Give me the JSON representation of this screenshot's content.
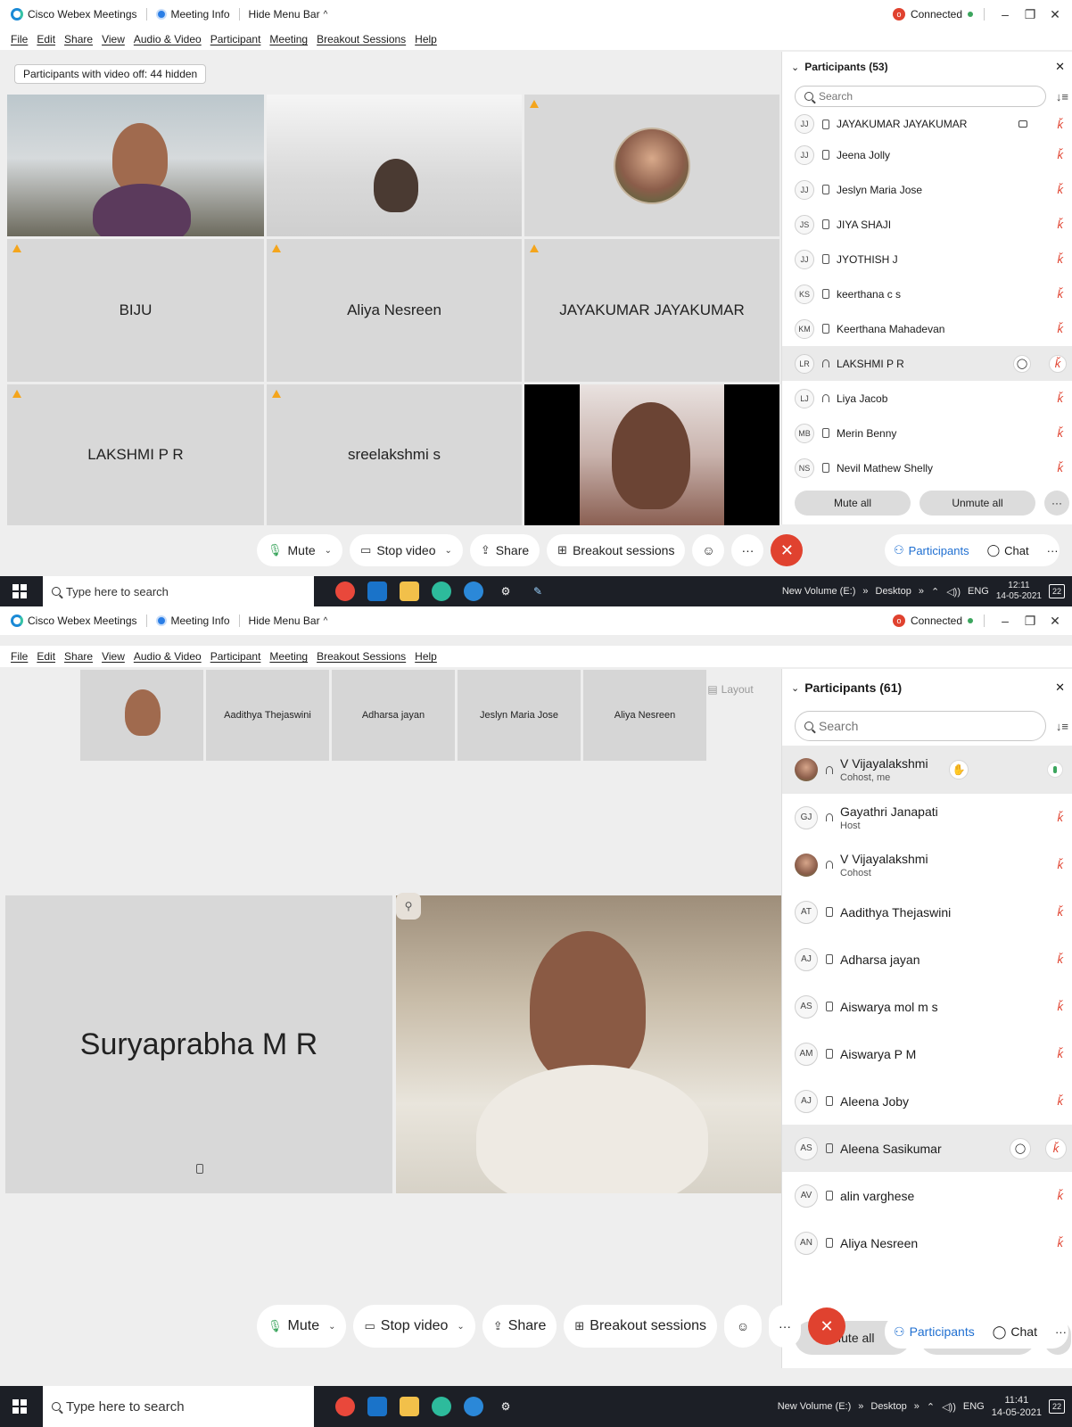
{
  "app": {
    "title": "Cisco Webex Meetings",
    "meeting_info": "Meeting Info",
    "hide_menu": "Hide Menu Bar",
    "connected": "Connected"
  },
  "menu": [
    "File",
    "Edit",
    "Share",
    "View",
    "Audio & Video",
    "Participant",
    "Meeting",
    "Breakout Sessions",
    "Help"
  ],
  "controls": {
    "mute": "Mute",
    "stop_video": "Stop video",
    "share": "Share",
    "breakout": "Breakout sessions",
    "participants": "Participants",
    "chat": "Chat",
    "more": "···"
  },
  "panel_common": {
    "search_placeholder": "Search",
    "mute_all": "Mute all",
    "unmute_all": "Unmute all"
  },
  "taskbar": {
    "search_placeholder": "Type here to search",
    "new_volume": "New Volume (E:)",
    "desktop": "Desktop",
    "lang": "ENG",
    "notifications": "22"
  },
  "screen1": {
    "hidden_note": "Participants with video off: 44 hidden",
    "tiles": [
      "BIJU",
      "Aliya Nesreen",
      "JAYAKUMAR JAYAKUMAR",
      "LAKSHMI P R",
      "sreelakshmi s"
    ],
    "panel_title": "Participants (53)",
    "participants": [
      {
        "initials": "JJ",
        "name": "JAYAKUMAR JAYAKUMAR"
      },
      {
        "initials": "JJ",
        "name": "Jeena Jolly"
      },
      {
        "initials": "JJ",
        "name": "Jeslyn Maria Jose"
      },
      {
        "initials": "JS",
        "name": "JIYA SHAJI"
      },
      {
        "initials": "JJ",
        "name": "JYOTHISH J"
      },
      {
        "initials": "KS",
        "name": "keerthana c s"
      },
      {
        "initials": "KM",
        "name": "Keerthana Mahadevan"
      },
      {
        "initials": "LR",
        "name": "LAKSHMI P R"
      },
      {
        "initials": "LJ",
        "name": "Liya Jacob"
      },
      {
        "initials": "MB",
        "name": "Merin Benny"
      },
      {
        "initials": "NS",
        "name": "Nevil Mathew Shelly"
      }
    ],
    "time": "12:11",
    "date": "14-05-2021"
  },
  "screen2": {
    "filmstrip": [
      "Aadithya Thejaswini",
      "Adharsa jayan",
      "Jeslyn Maria Jose",
      "Aliya Nesreen"
    ],
    "layout": "Layout",
    "main_tile": "Suryaprabha M R",
    "panel_title": "Participants (61)",
    "participants": [
      {
        "initials": "",
        "name": "V Vijayalakshmi",
        "role": "Cohost, me"
      },
      {
        "initials": "GJ",
        "name": "Gayathri Janapati",
        "role": "Host"
      },
      {
        "initials": "",
        "name": "V Vijayalakshmi",
        "role": "Cohost"
      },
      {
        "initials": "AT",
        "name": "Aadithya Thejaswini"
      },
      {
        "initials": "AJ",
        "name": "Adharsa jayan"
      },
      {
        "initials": "AS",
        "name": "Aiswarya mol m s"
      },
      {
        "initials": "AM",
        "name": "Aiswarya P M"
      },
      {
        "initials": "AJ",
        "name": "Aleena Joby"
      },
      {
        "initials": "AS",
        "name": "Aleena Sasikumar"
      },
      {
        "initials": "AV",
        "name": "alin varghese"
      },
      {
        "initials": "AN",
        "name": "Aliya Nesreen"
      }
    ],
    "time": "11:41",
    "date": "14-05-2021"
  }
}
